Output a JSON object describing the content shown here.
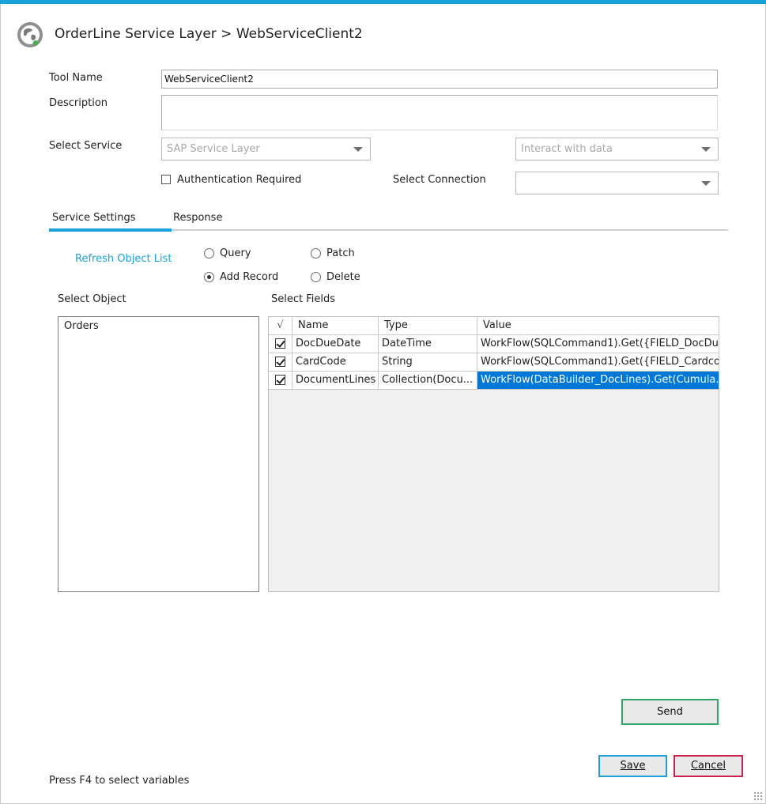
{
  "header": {
    "title": "OrderLine Service Layer > WebServiceClient2",
    "icon": "globe-icon"
  },
  "form": {
    "tool_name_label": "Tool Name",
    "tool_name_value": "WebServiceClient2",
    "description_label": "Description",
    "description_value": "",
    "select_service_label": "Select Service",
    "service_value": "SAP Service Layer",
    "interaction_value": "Interact with data",
    "auth_label": "Authentication Required",
    "auth_checked": false,
    "select_connection_label": "Select Connection",
    "connection_value": ""
  },
  "tabs": [
    {
      "label": "Service Settings",
      "active": true
    },
    {
      "label": "Response",
      "active": false
    }
  ],
  "service_settings": {
    "refresh_link": "Refresh Object List",
    "radios": [
      {
        "label": "Query",
        "selected": false
      },
      {
        "label": "Patch",
        "selected": false
      },
      {
        "label": "Add Record",
        "selected": true
      },
      {
        "label": "Delete",
        "selected": false
      }
    ],
    "select_object_label": "Select Object",
    "objects": [
      "Orders"
    ],
    "select_fields_label": "Select Fields",
    "grid": {
      "columns": [
        "√",
        "Name",
        "Type",
        "Value"
      ],
      "rows": [
        {
          "checked": true,
          "name": "DocDueDate",
          "type": "DateTime",
          "value": "WorkFlow(SQLCommand1).Get({FIELD_DocDu...",
          "selected": false
        },
        {
          "checked": true,
          "name": "CardCode",
          "type": "String",
          "value": "WorkFlow(SQLCommand1).Get({FIELD_Cardco...",
          "selected": false
        },
        {
          "checked": true,
          "name": "DocumentLines",
          "type": "Collection(Docu...",
          "value": "WorkFlow(DataBuilder_DocLines).Get(Cumula...",
          "selected": true
        }
      ]
    }
  },
  "buttons": {
    "send": "Send",
    "save": "Save",
    "cancel": "Cancel"
  },
  "footer": {
    "hint": "Press F4 to select variables"
  },
  "colors": {
    "accent": "#1aa1d9",
    "send_border": "#2fa66a",
    "cancel_border": "#c8204f",
    "selection": "#0078d7"
  }
}
